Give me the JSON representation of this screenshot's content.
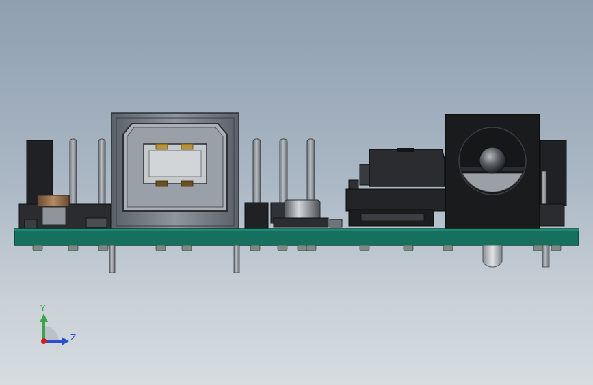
{
  "viewport": {
    "background_top": "#8f9fb1",
    "background_bottom": "#d6dcdf"
  },
  "triad": {
    "y_label": "Y",
    "z_label": "Z",
    "colors": {
      "y": "#3aa64a",
      "z": "#2a4fd0",
      "origin": "#d02020"
    }
  },
  "model": {
    "pcb_color": "#16705e",
    "components": [
      "pin-header-left",
      "usb-b-connector",
      "pin-header-middle",
      "voltage-regulator",
      "dc-power-jack",
      "pin-header-right"
    ]
  }
}
